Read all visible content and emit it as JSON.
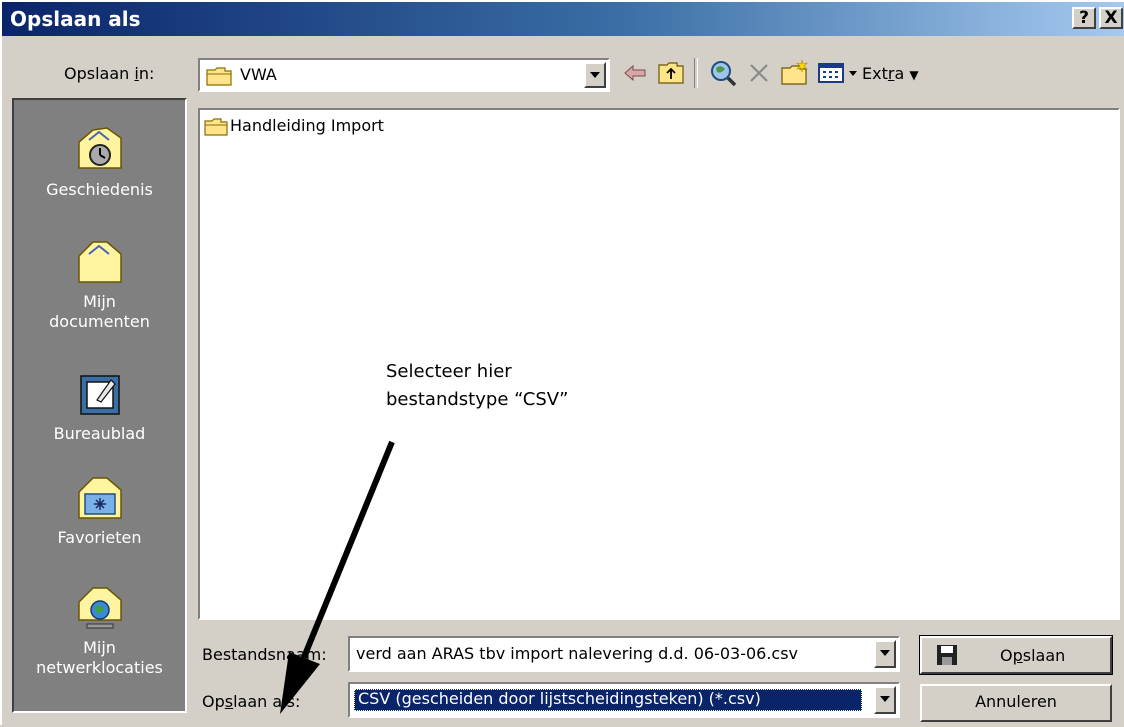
{
  "title": "Opslaan als",
  "title_buttons": {
    "help": "?",
    "close": "X"
  },
  "save_in": {
    "label_pre": "Opslaan ",
    "label_key": "i",
    "label_post": "n:",
    "folder": "VWA"
  },
  "toolbar": {
    "extra_pre": "Ext",
    "extra_key": "r",
    "extra_post": "a",
    "icons": [
      "back-arrow-icon",
      "up-folder-icon",
      "search-web-icon",
      "delete-icon",
      "new-folder-icon",
      "views-icon"
    ]
  },
  "places": [
    {
      "label": "Geschiedenis",
      "icon": "history-icon"
    },
    {
      "label": "Mijn documenten",
      "icon": "my-documents-icon"
    },
    {
      "label": "Bureaublad",
      "icon": "desktop-icon"
    },
    {
      "label": "Favorieten",
      "icon": "favorites-icon"
    },
    {
      "label": "Mijn netwerklocaties",
      "icon": "network-places-icon"
    }
  ],
  "files": [
    {
      "name": "Handleiding Import",
      "type": "folder"
    }
  ],
  "filename": {
    "label": "Bestandsnaam:",
    "value": "verd aan ARAS tbv import nalevering d.d. 06-03-06.csv"
  },
  "filetype": {
    "label_pre": "Op",
    "label_key": "s",
    "label_post": "laan als:",
    "value": "CSV (gescheiden door lijstscheidingsteken) (*.csv)"
  },
  "buttons": {
    "save_pre": "O",
    "save_key": "p",
    "save_post": "slaan",
    "cancel": "Annuleren"
  },
  "annotation": {
    "line1": "Selecteer hier",
    "line2": "bestandstype “CSV”"
  },
  "colors": {
    "titlebar": "#0a246a",
    "selection": "#0a246a",
    "face": "#d4d0c8"
  }
}
